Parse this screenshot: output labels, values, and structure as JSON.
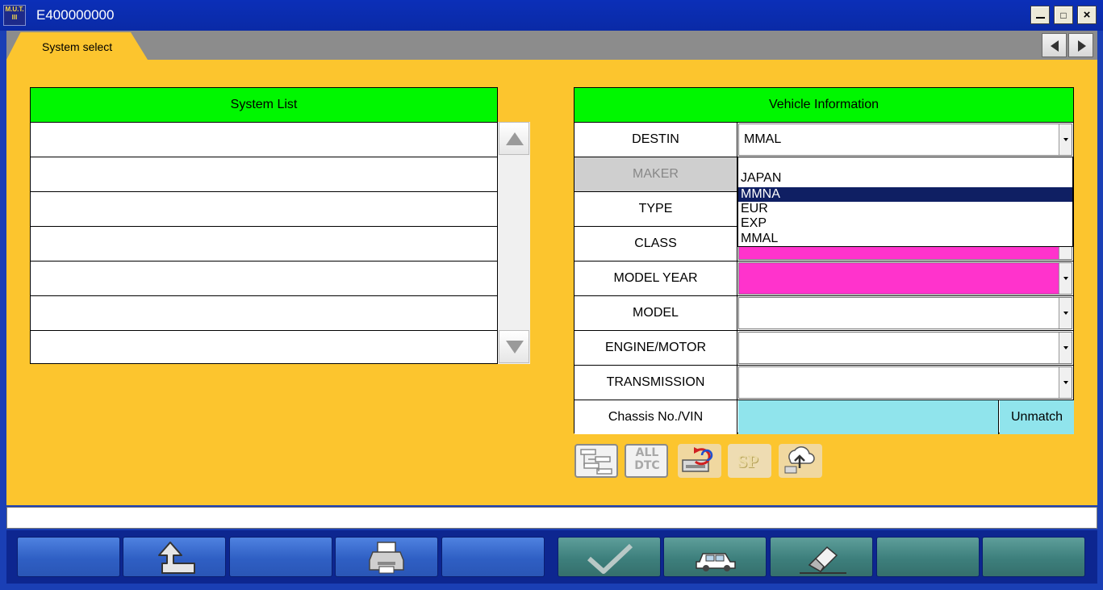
{
  "window": {
    "logo_text": "M.U.T. III",
    "title": "E400000000",
    "maximize_glyph": "□",
    "close_glyph": "×"
  },
  "tabs": [
    {
      "label": "System select",
      "active": true
    }
  ],
  "system_list": {
    "header": "System List",
    "rows": [
      "",
      "",
      "",
      "",
      "",
      "",
      ""
    ]
  },
  "vehicle_info": {
    "header": "Vehicle Information",
    "fields": [
      {
        "label": "DESTIN",
        "value": "MMAL",
        "type": "dropdown",
        "highlight": "none"
      },
      {
        "label": "MAKER",
        "value": "",
        "type": "dropdown",
        "enabled": false
      },
      {
        "label": "TYPE",
        "value": "",
        "type": "dropdown"
      },
      {
        "label": "CLASS",
        "value": "",
        "type": "dropdown",
        "highlight": "#ff33cc"
      },
      {
        "label": "MODEL YEAR",
        "value": "",
        "type": "dropdown",
        "highlight": "#ff33cc"
      },
      {
        "label": "MODEL",
        "value": "",
        "type": "dropdown"
      },
      {
        "label": "ENGINE/MOTOR",
        "value": "",
        "type": "dropdown"
      },
      {
        "label": "TRANSMISSION",
        "value": "",
        "type": "dropdown"
      }
    ],
    "vin": {
      "label": "Chassis No./VIN",
      "value": "",
      "status": "Unmatch"
    }
  },
  "destin_dropdown": {
    "open": true,
    "options": [
      "JAPAN",
      "MMNA",
      "EUR",
      "EXP",
      "MMAL"
    ],
    "highlighted": "MMNA"
  },
  "tools": {
    "all_dtc_line1": "ALL",
    "all_dtc_line2": "DTC",
    "sp_label": "SP",
    "icons": [
      "system-tree-icon",
      "all-dtc-icon",
      "ecu-reprogram-icon",
      "special-function-icon",
      "data-upload-icon"
    ]
  },
  "status_text": "",
  "bottom_toolbar": {
    "left_buttons": [
      "blank",
      "back-arrow-icon",
      "blank",
      "printer-icon",
      "blank"
    ],
    "right_buttons": [
      "checkmark-icon",
      "car-icon",
      "eraser-icon",
      "blank",
      "blank"
    ]
  },
  "colors": {
    "title_bar": "#0b2fb8",
    "background": "#fcc52e",
    "header_green": "#00f700",
    "required_pink": "#ff33cc",
    "vin_cyan": "#90e4ec",
    "selected_option": "#0f1f63",
    "button_blue": "#3a6ad0",
    "button_green": "#4a8a86"
  }
}
